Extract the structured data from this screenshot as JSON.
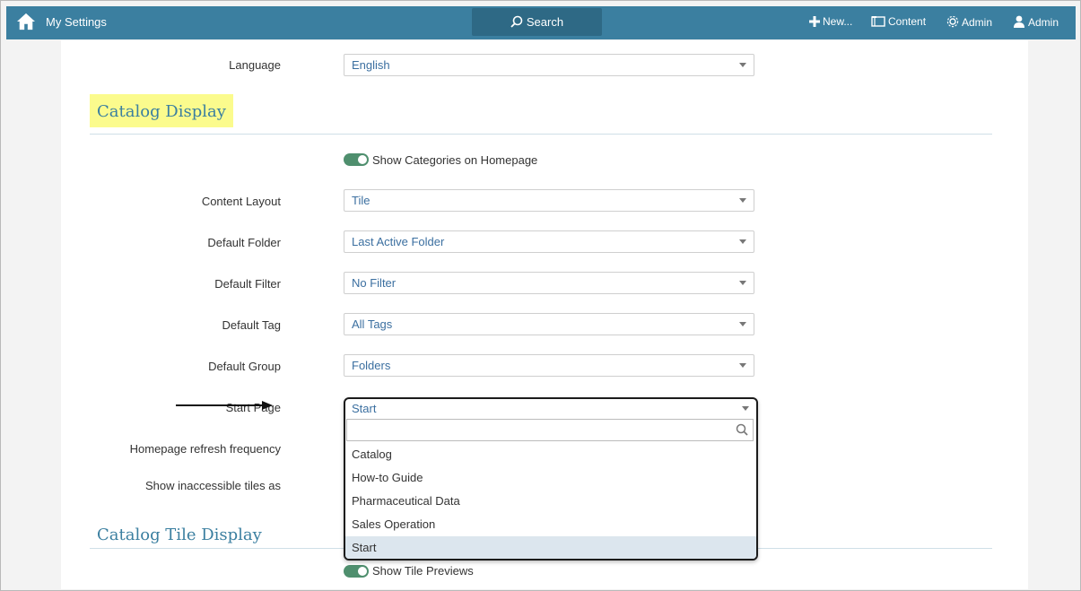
{
  "header": {
    "title": "My Settings",
    "search_label": "Search",
    "new_label": "New...",
    "content_label": "Content",
    "admin_label": "Admin",
    "user_label": "Admin"
  },
  "language": {
    "label": "Language",
    "value": "English"
  },
  "catalog_display": {
    "title": "Catalog Display",
    "toggle_label": "Show Categories on Homepage",
    "fields": {
      "content_layout": {
        "label": "Content Layout",
        "value": "Tile"
      },
      "default_folder": {
        "label": "Default Folder",
        "value": "Last Active Folder"
      },
      "default_filter": {
        "label": "Default Filter",
        "value": "No Filter"
      },
      "default_tag": {
        "label": "Default Tag",
        "value": "All Tags"
      },
      "default_group": {
        "label": "Default Group",
        "value": "Folders"
      },
      "start_page": {
        "label": "Start Page",
        "value": "Start"
      },
      "refresh": {
        "label": "Homepage refresh frequency"
      },
      "inaccessible": {
        "label": "Show inaccessible tiles as"
      }
    }
  },
  "start_page_dropdown": {
    "search_value": "",
    "options": [
      "Catalog",
      "How-to Guide",
      "Pharmaceutical Data",
      "Sales Operation",
      "Start"
    ],
    "selected": "Start"
  },
  "catalog_tile_display": {
    "title": "Catalog Tile Display",
    "toggle_label": "Show Tile Previews"
  },
  "colors": {
    "nav_bar": "#3b7fa0",
    "search_button": "#2e6985",
    "toggle_on": "#4f8f6e",
    "highlight": "#fbfb8d",
    "selected_option": "#dce6ee"
  }
}
